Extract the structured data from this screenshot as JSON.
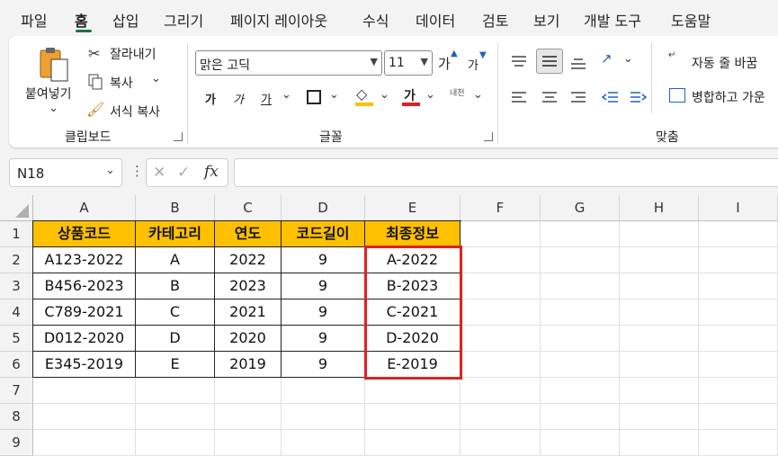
{
  "menu": {
    "tabs": [
      "파일",
      "홈",
      "삽입",
      "그리기",
      "페이지 레이아웃",
      "수식",
      "데이터",
      "검토",
      "보기",
      "개발 도구",
      "도움말"
    ],
    "active_tab": "홈"
  },
  "ribbon": {
    "clipboard": {
      "paste_label": "붙여넣기",
      "cut_label": "잘라내기",
      "copy_label": "복사",
      "format_painter_label": "서식 복사",
      "group_label": "클립보드"
    },
    "font": {
      "font_name": "맑은 고딕",
      "font_size": "11",
      "bold_label": "가",
      "italic_label": "가",
      "underline_label": "가",
      "font_color_label": "가",
      "phonetic_label": "내천",
      "grow_label": "가",
      "shrink_label": "가",
      "group_label": "글꼴",
      "highlight_color": "#ffc000",
      "font_color": "#e02020"
    },
    "alignment": {
      "wrap_text_label": "자동 줄 바꿈",
      "merge_label": "병합하고 가운",
      "group_label": "맞춤"
    }
  },
  "formula_bar": {
    "name_box": "N18",
    "fx_label": "fx",
    "formula": ""
  },
  "sheet": {
    "columns": [
      "A",
      "B",
      "C",
      "D",
      "E",
      "F",
      "G",
      "H",
      "I"
    ],
    "rows": [
      "1",
      "2",
      "3",
      "4",
      "5",
      "6",
      "7",
      "8",
      "9"
    ],
    "headers": [
      "상품코드",
      "카테고리",
      "연도",
      "코드길이",
      "최종정보"
    ],
    "data": [
      [
        "A123-2022",
        "A",
        "2022",
        "9",
        "A-2022"
      ],
      [
        "B456-2023",
        "B",
        "2023",
        "9",
        "B-2023"
      ],
      [
        "C789-2021",
        "C",
        "2021",
        "9",
        "C-2021"
      ],
      [
        "D012-2020",
        "D",
        "2020",
        "9",
        "D-2020"
      ],
      [
        "E345-2019",
        "E",
        "2019",
        "9",
        "E-2019"
      ]
    ],
    "header_fill": "#ffc000",
    "highlight_border": "#e02020"
  }
}
